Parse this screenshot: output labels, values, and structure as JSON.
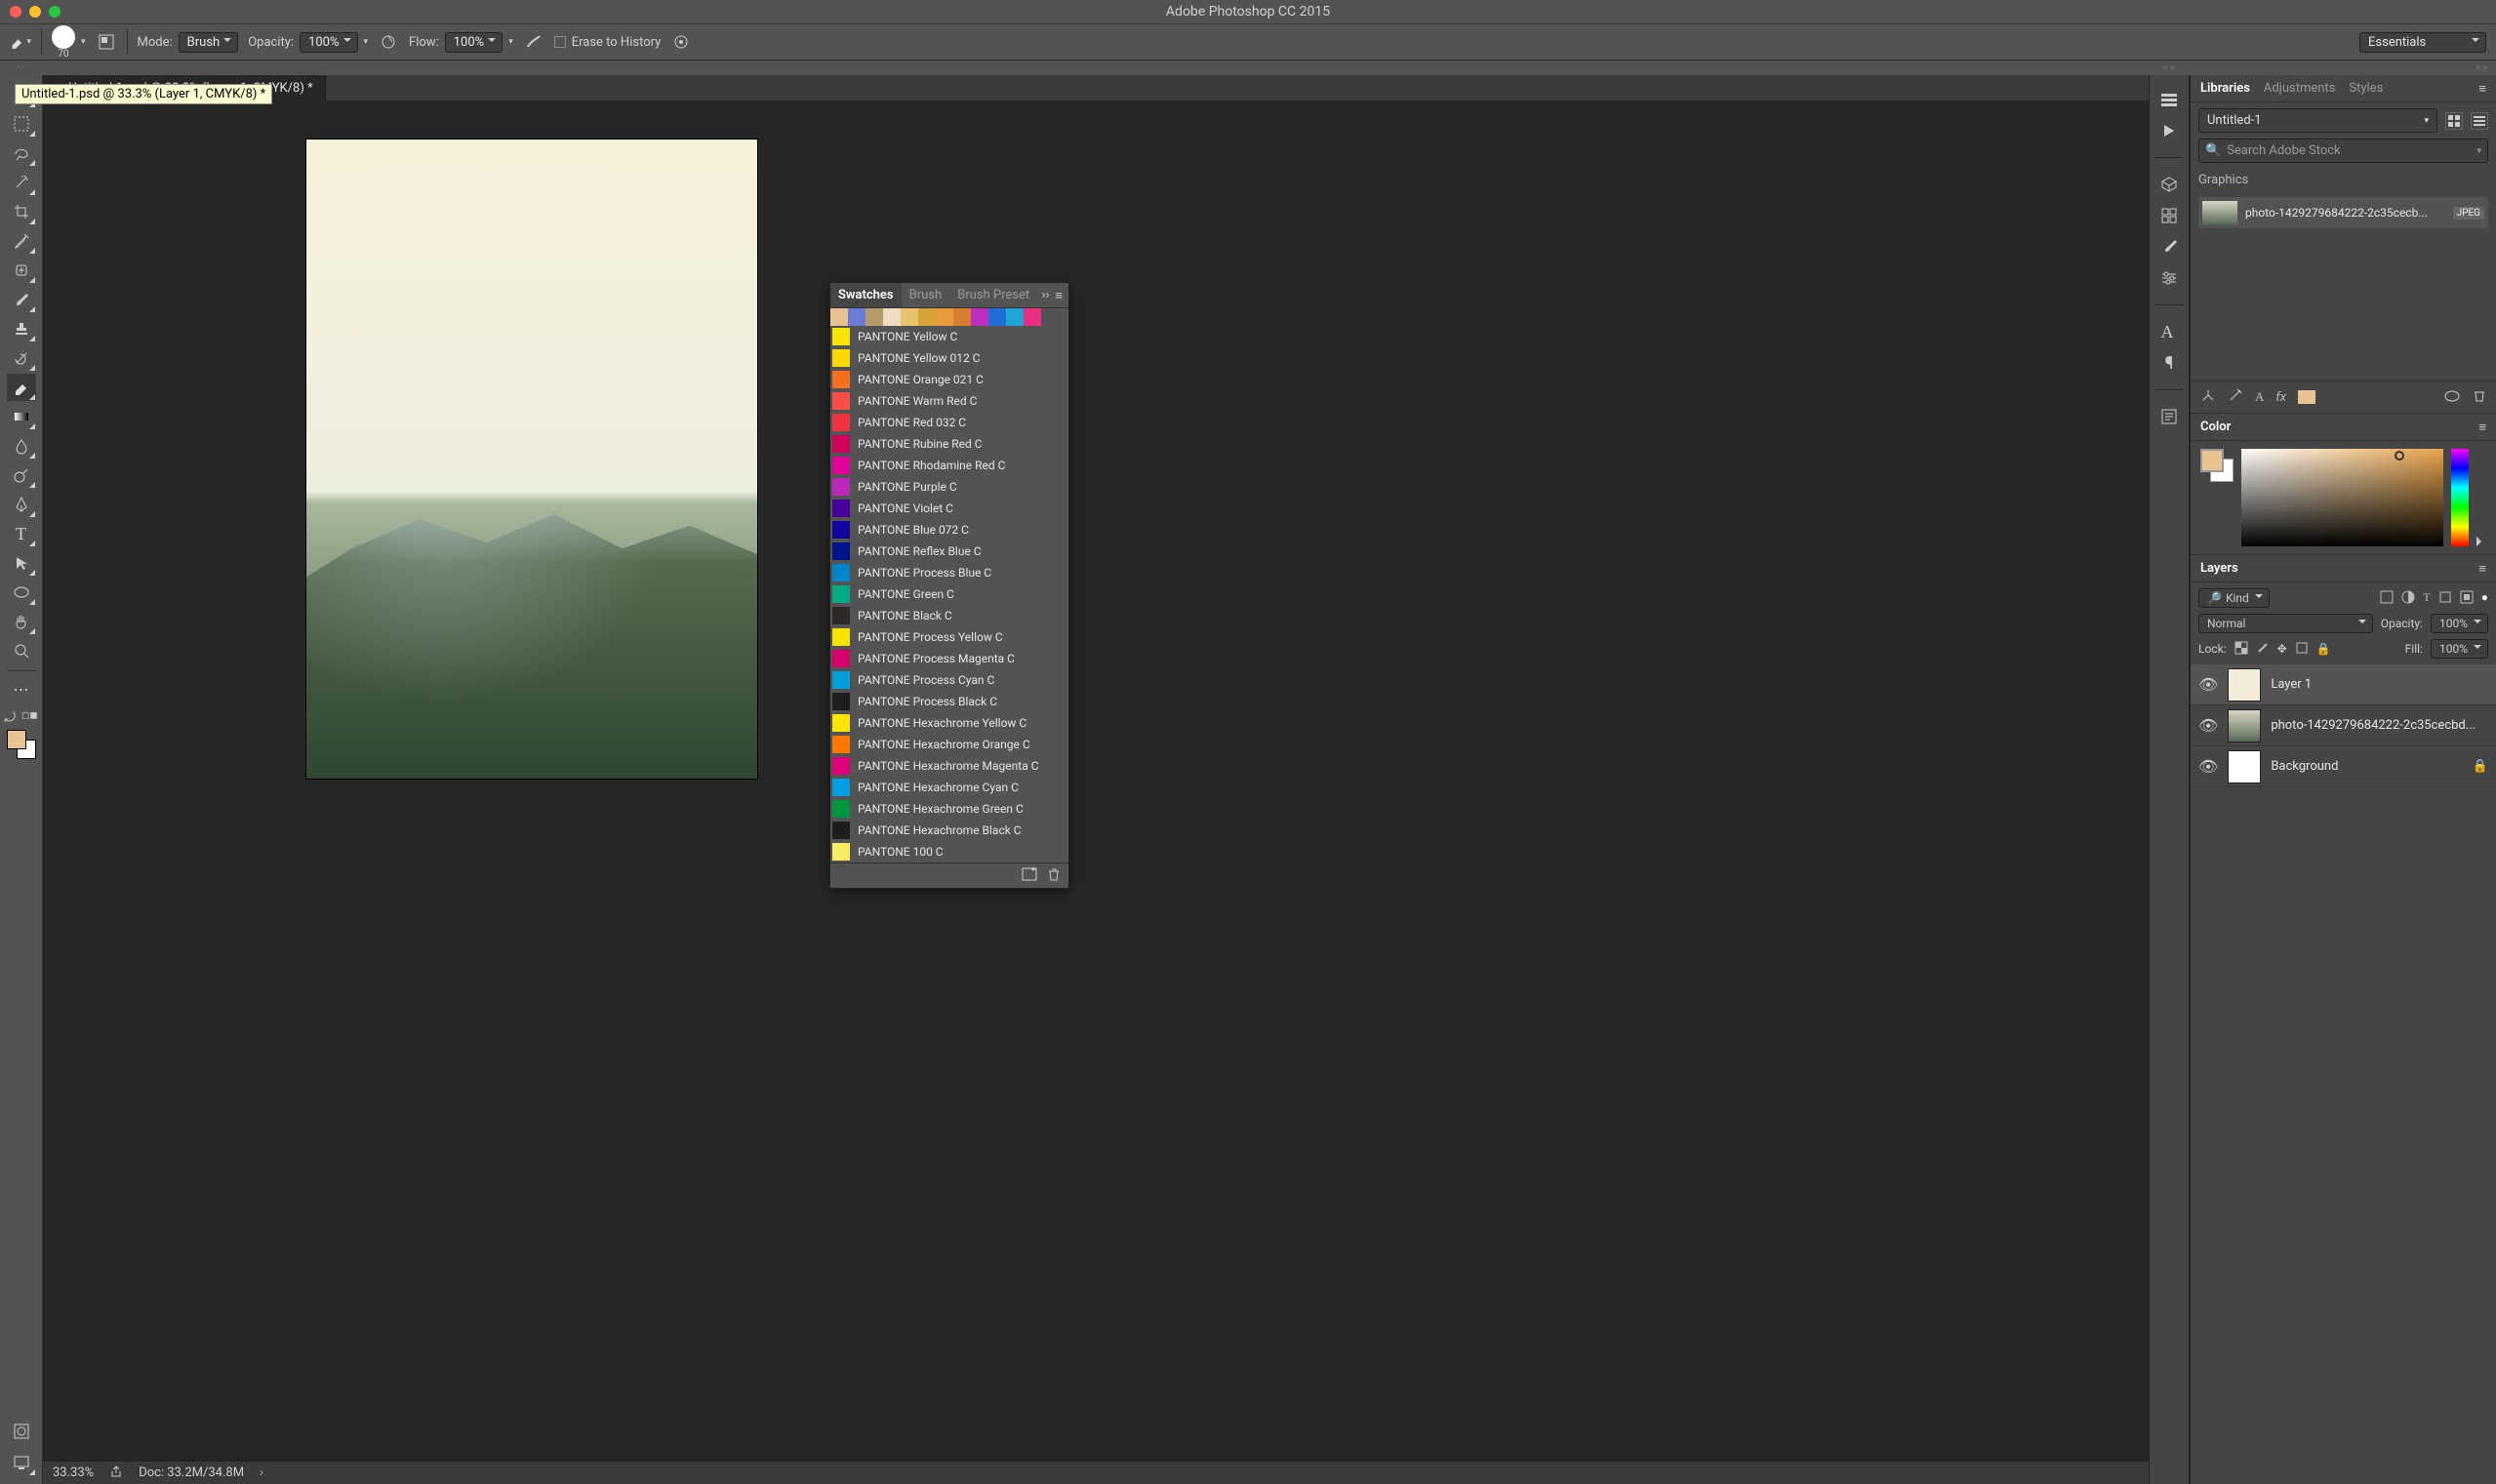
{
  "title": "Adobe Photoshop CC 2015",
  "options_bar": {
    "brush_size": "70",
    "mode_label": "Mode:",
    "mode_value": "Brush",
    "opacity_label": "Opacity:",
    "opacity_value": "100%",
    "flow_label": "Flow:",
    "flow_value": "100%",
    "erase_history_label": "Erase to History",
    "workspace": "Essentials"
  },
  "document": {
    "tab_title": "Untitled-1.psd @ 33.3% (Layer 1, CMYK/8) *",
    "tooltip": "Untitled-1.psd @ 33.3% (Layer 1, CMYK/8) *"
  },
  "status_bar": {
    "zoom": "33.33%",
    "doc_info": "Doc: 33.2M/34.8M"
  },
  "swatches_panel": {
    "tabs": [
      "Swatches",
      "Brush",
      "Brush Preset"
    ],
    "top_row_colors": [
      "#e8c391",
      "#6b7bd6",
      "#b59a6b",
      "#f0dcc2",
      "#e6c36d",
      "#d6a23a",
      "#e89a3c",
      "#d67f30",
      "#bf2fbf",
      "#1f6ed6",
      "#1ea7d6",
      "#e82f82"
    ],
    "items": [
      {
        "name": "PANTONE Yellow C",
        "color": "#f4e400"
      },
      {
        "name": "PANTONE Yellow 012 C",
        "color": "#fbd800"
      },
      {
        "name": "PANTONE Orange 021 C",
        "color": "#f36f21"
      },
      {
        "name": "PANTONE Warm Red C",
        "color": "#f94f46"
      },
      {
        "name": "PANTONE Red 032 C",
        "color": "#ef3340"
      },
      {
        "name": "PANTONE Rubine Red C",
        "color": "#ce0058"
      },
      {
        "name": "PANTONE Rhodamine Red C",
        "color": "#e10098"
      },
      {
        "name": "PANTONE Purple C",
        "color": "#bb29bb"
      },
      {
        "name": "PANTONE Violet C",
        "color": "#440099"
      },
      {
        "name": "PANTONE Blue 072 C",
        "color": "#10069f"
      },
      {
        "name": "PANTONE Reflex Blue C",
        "color": "#001489"
      },
      {
        "name": "PANTONE Process Blue C",
        "color": "#0085ca"
      },
      {
        "name": "PANTONE Green C",
        "color": "#00ab84"
      },
      {
        "name": "PANTONE Black C",
        "color": "#2d2926"
      },
      {
        "name": "PANTONE Process Yellow C",
        "color": "#f7e300"
      },
      {
        "name": "PANTONE Process Magenta C",
        "color": "#d6006d"
      },
      {
        "name": "PANTONE Process Cyan C",
        "color": "#009fda"
      },
      {
        "name": "PANTONE Process Black C",
        "color": "#1e1e1e"
      },
      {
        "name": "PANTONE Hexachrome Yellow C",
        "color": "#ffe600"
      },
      {
        "name": "PANTONE Hexachrome Orange C",
        "color": "#ff7900"
      },
      {
        "name": "PANTONE Hexachrome Magenta C",
        "color": "#de007b"
      },
      {
        "name": "PANTONE Hexachrome Cyan C",
        "color": "#009fe3"
      },
      {
        "name": "PANTONE Hexachrome Green C",
        "color": "#009640"
      },
      {
        "name": "PANTONE Hexachrome Black C",
        "color": "#1d1d1b"
      },
      {
        "name": "PANTONE 100 C",
        "color": "#f6eb61"
      }
    ]
  },
  "libraries_panel": {
    "tabs": [
      "Libraries",
      "Adjustments",
      "Styles"
    ],
    "library_name": "Untitled-1",
    "search_placeholder": "Search Adobe Stock",
    "section": "Graphics",
    "asset_name": "photo-1429279684222-2c35cecb...",
    "asset_badge": "JPEG"
  },
  "color_panel": {
    "title": "Color"
  },
  "layers_panel": {
    "title": "Layers",
    "filter_kind": "Kind",
    "blend_mode": "Normal",
    "opacity_label": "Opacity:",
    "opacity_value": "100%",
    "lock_label": "Lock:",
    "fill_label": "Fill:",
    "fill_value": "100%",
    "layers": [
      {
        "name": "Layer 1",
        "thumb": "solid",
        "locked": false
      },
      {
        "name": "photo-1429279684222-2c35cecbd...",
        "thumb": "image",
        "locked": false
      },
      {
        "name": "Background",
        "thumb": "white",
        "locked": true
      }
    ]
  }
}
